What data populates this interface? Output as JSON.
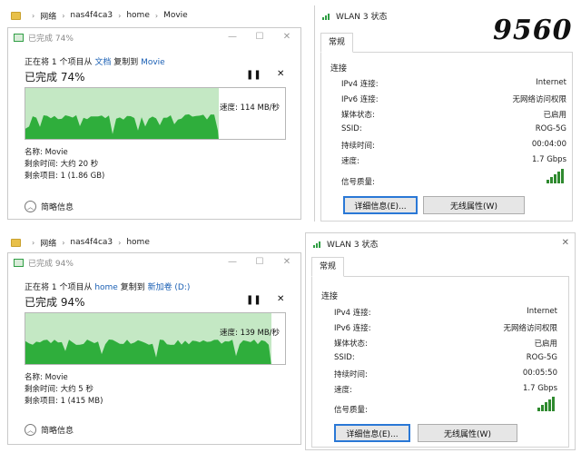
{
  "panels": [
    {
      "address": [
        "网络",
        "nas4f4ca3",
        "home",
        "Movie"
      ],
      "copy": {
        "title": "已完成 74%",
        "line_prefix": "正在将 1 个项目从 ",
        "source": "文档",
        "middle": " 复制到 ",
        "dest": "Movie",
        "percent_label": "已完成 74%",
        "progress": 0.74,
        "speed": "速度: 114 MB/秒",
        "name": "名称: Movie",
        "remaining_time": "剩余时间: 大约 20 秒",
        "remaining_items": "剩余项目: 1 (1.86 GB)",
        "less": "简略信息"
      },
      "wlan": {
        "title": "WLAN 3 状态",
        "tab": "常规",
        "section": "连接",
        "rows": [
          {
            "label": "IPv4 连接:",
            "value": "Internet"
          },
          {
            "label": "IPv6 连接:",
            "value": "无网络访问权限"
          },
          {
            "label": "媒体状态:",
            "value": "已启用"
          },
          {
            "label": "SSID:",
            "value": "ROG-5G"
          },
          {
            "label": "持续时间:",
            "value": "00:04:00"
          },
          {
            "label": "速度:",
            "value": "1.7 Gbps"
          }
        ],
        "signal_label": "信号质量:",
        "btn_details": "详细信息(E)...",
        "btn_wireless": "无线属性(W)"
      }
    },
    {
      "address": [
        "网络",
        "nas4f4ca3",
        "home"
      ],
      "copy": {
        "title": "已完成 94%",
        "line_prefix": "正在将 1 个项目从 ",
        "source": "home",
        "middle": " 复制到 ",
        "dest": "新加卷 (D:)",
        "percent_label": "已完成 94%",
        "progress": 0.94,
        "speed": "速度: 139 MB/秒",
        "name": "名称: Movie",
        "remaining_time": "剩余时间: 大约 5 秒",
        "remaining_items": "剩余项目: 1 (415 MB)",
        "less": "简略信息"
      },
      "wlan": {
        "title": "WLAN 3 状态",
        "tab": "常规",
        "section": "连接",
        "rows": [
          {
            "label": "IPv4 连接:",
            "value": "Internet"
          },
          {
            "label": "IPv6 连接:",
            "value": "无网络访问权限"
          },
          {
            "label": "媒体状态:",
            "value": "已启用"
          },
          {
            "label": "SSID:",
            "value": "ROG-5G"
          },
          {
            "label": "持续时间:",
            "value": "00:05:50"
          },
          {
            "label": "速度:",
            "value": "1.7 Gbps"
          }
        ],
        "signal_label": "信号质量:",
        "btn_details": "详细信息(E)...",
        "btn_wireless": "无线属性(W)"
      }
    }
  ],
  "handwritten_label": "9560",
  "colors": {
    "progress_fill": "#c4e8c4",
    "graph_fill": "#2fae3c",
    "link": "#1a5fb4"
  }
}
